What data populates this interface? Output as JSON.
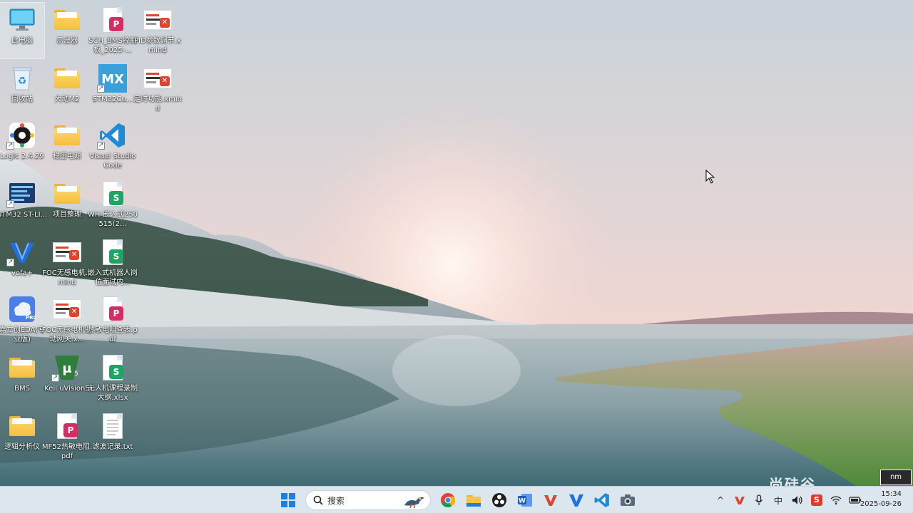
{
  "desktop": {
    "icons": [
      {
        "label": "此电脑"
      },
      {
        "label": "示波器"
      },
      {
        "label": "SCH_BMS控制板_2025-..."
      },
      {
        "label": "PID参数调节.xmind"
      },
      {
        "label": "回收站"
      },
      {
        "label": "大动M2"
      },
      {
        "label": "STM32Cu..."
      },
      {
        "label": "定时功能.xmind"
      },
      {
        "label": "Logic 2.4.29"
      },
      {
        "label": "稳压电源"
      },
      {
        "label": "Visual Studio Code"
      },
      {
        "label": "STM32 ST-LI..."
      },
      {
        "label": "项目整理"
      },
      {
        "label": "WH-嵌入式250515(2..."
      },
      {
        "label": "vofa+"
      },
      {
        "label": "FOC无感电机.xmind"
      },
      {
        "label": "嵌入式机器人岗位面试内..."
      },
      {
        "label": "嘉立创EDA(专业版)"
      },
      {
        "label": "FOC无感电机驱动网关.x..."
      },
      {
        "label": "热敏电阻查表.pdf"
      },
      {
        "label": "BMS"
      },
      {
        "label": "Keil uVision5"
      },
      {
        "label": "无人机课程录制大纲.xlsx"
      },
      {
        "label": "逻辑分析仪"
      },
      {
        "label": "MF52热敏电阻.pdf"
      },
      {
        "label": "滤波记录.txt"
      }
    ]
  },
  "taskbar": {
    "search_placeholder": "搜索",
    "icons": [
      "start-icon",
      "search-icon",
      "chrome-icon",
      "file-explorer-icon",
      "obs-icon",
      "word-icon",
      "wps-icon",
      "vofa-icon",
      "vscode-icon",
      "camera-icon"
    ],
    "tray": {
      "chevron": "^",
      "ime": "中",
      "ime_badge": "S"
    },
    "clock": {
      "time": "15:34",
      "date": "2025-09-26"
    }
  },
  "overlay": {
    "watermark": "尚硅谷",
    "watermark_box": "nm"
  },
  "colors": {
    "taskbar_bg": "#dce6ee",
    "folder": "#f4bf3e",
    "vscode": "#1f8ad6",
    "wps_red": "#e0442e",
    "excel_green": "#20a464",
    "pdf_pink": "#d52d63"
  }
}
